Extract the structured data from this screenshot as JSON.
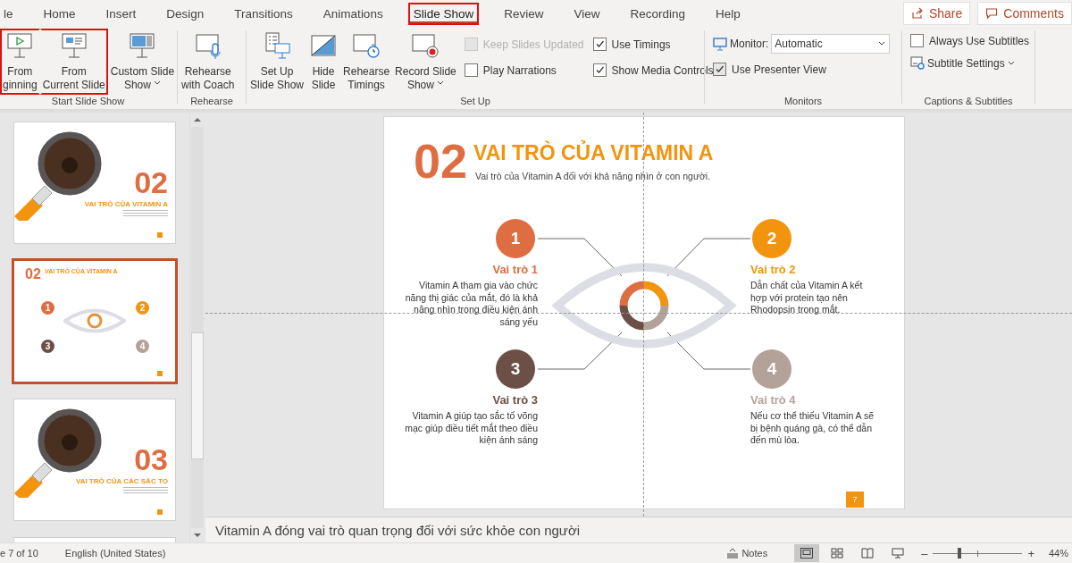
{
  "tabs": [
    {
      "label": "le",
      "selected": false,
      "boxed": false
    },
    {
      "label": "Home",
      "selected": false,
      "boxed": false
    },
    {
      "label": "Insert",
      "selected": false,
      "boxed": false
    },
    {
      "label": "Design",
      "selected": false,
      "boxed": false
    },
    {
      "label": "Transitions",
      "selected": false,
      "boxed": false
    },
    {
      "label": "Animations",
      "selected": false,
      "boxed": false
    },
    {
      "label": "Slide Show",
      "selected": true,
      "boxed": true
    },
    {
      "label": "Review",
      "selected": false,
      "boxed": false
    },
    {
      "label": "View",
      "selected": false,
      "boxed": false
    },
    {
      "label": "Recording",
      "selected": false,
      "boxed": false
    },
    {
      "label": "Help",
      "selected": false,
      "boxed": false
    }
  ],
  "share": "Share",
  "comments": "Comments",
  "start_group": {
    "label": "Start Slide Show",
    "buttons": [
      {
        "lines": [
          "From",
          "ginning"
        ],
        "dropdown": false,
        "boxed": true
      },
      {
        "lines": [
          "From",
          "Current Slide"
        ],
        "dropdown": false,
        "boxed": true
      },
      {
        "lines": [
          "Custom Slide",
          "Show"
        ],
        "dropdown": true,
        "boxed": false
      }
    ]
  },
  "rehearse_group": {
    "label": "Rehearse",
    "buttons": [
      {
        "lines": [
          "Rehearse",
          "with Coach"
        ]
      }
    ]
  },
  "setup_group": {
    "label": "Set Up",
    "buttons": [
      {
        "lines": [
          "Set Up",
          "Slide Show"
        ],
        "dropdown": false
      },
      {
        "lines": [
          "Hide",
          "Slide"
        ],
        "dropdown": false
      },
      {
        "lines": [
          "Rehearse",
          "Timings"
        ],
        "dropdown": false
      },
      {
        "lines": [
          "Record Slide",
          "Show"
        ],
        "dropdown": true
      }
    ],
    "options": [
      {
        "label": "Keep Slides Updated",
        "checked": false,
        "disabled": true
      },
      {
        "label": "Use Timings",
        "checked": true,
        "disabled": false
      },
      {
        "label": "Play Narrations",
        "checked": false,
        "disabled": false
      },
      {
        "label": "Show Media Controls",
        "checked": true,
        "disabled": false
      }
    ]
  },
  "monitors_group": {
    "label": "Monitors",
    "monitor_label": "Monitor:",
    "monitor_value": "Automatic",
    "presenter": {
      "label": "Use Presenter View",
      "checked": true
    }
  },
  "captions_group": {
    "label": "Captions & Subtitles",
    "always": {
      "label": "Always Use Subtitles",
      "checked": false
    },
    "settings": "Subtitle Settings"
  },
  "thumbnails": [
    {
      "kind": "section",
      "number": "02",
      "title": "VAI TRÒ CỦA VITAMIN A",
      "selected": false
    },
    {
      "kind": "roles",
      "number": "02",
      "title": "VAI TRÒ CỦA VITAMIN A",
      "selected": true,
      "badges": [
        "1",
        "2",
        "3",
        "4"
      ]
    },
    {
      "kind": "section",
      "number": "03",
      "title": "VAI TRÒ CỦA CÁC SẮC TỐ",
      "selected": false
    }
  ],
  "slide": {
    "number": "02",
    "title": "VAI TRÒ CỦA VITAMIN A",
    "subtitle": "Vai trò của Vitamin A đối với khả năng nhìn ở con người.",
    "roles": [
      {
        "badge": "1",
        "heading": "Vai trò 1",
        "text": "Vitamin A tham gia vào chức năng thị giác của mắt, đó là khả năng nhìn trong điều kiện ánh sáng yếu",
        "color": "#df6d42"
      },
      {
        "badge": "2",
        "heading": "Vai trò 2",
        "text": "Dẫn chất của Vitamin A kết hợp với protein tạo nên Rhodopsin trong mắt.",
        "color": "#f3940f"
      },
      {
        "badge": "3",
        "heading": "Vai trò 3",
        "text": "Vitamin A giúp tạo sắc tố võng mạc giúp điều tiết mắt theo điều kiện ánh sáng",
        "color": "#6c5048"
      },
      {
        "badge": "4",
        "heading": "Vai trò 4",
        "text": "Nếu cơ thể thiếu Vitamin A sẽ bị bệnh quáng gà, có thể dẫn đến mù lòa.",
        "color": "#b3a29a"
      }
    ],
    "page": "7"
  },
  "notes": "Vitamin A đóng vai trò quan trọng đối với sức khỏe con người",
  "status": {
    "slide_info": "e 7 of 10",
    "language": "English (United States)",
    "notes_button": "Notes",
    "views": [
      {
        "selected": true
      },
      {
        "selected": false
      },
      {
        "selected": false
      },
      {
        "selected": false
      }
    ],
    "zoom_out": "–",
    "zoom": {
      "level": 0.3
    },
    "zoom_in": "+",
    "zoom_value": "44%"
  }
}
